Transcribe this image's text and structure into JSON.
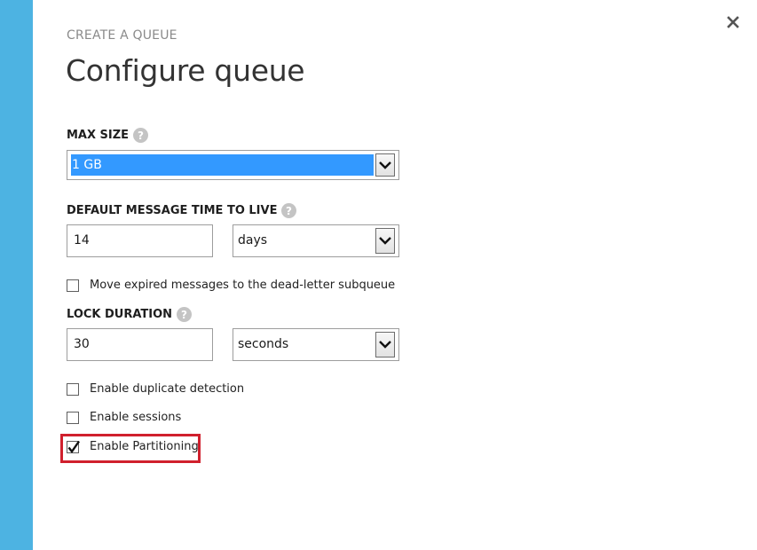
{
  "dialog": {
    "eyebrow": "CREATE A QUEUE",
    "title": "Configure queue",
    "close_icon": "close-icon",
    "accent_color": "#4db3e2"
  },
  "max_size": {
    "label": "MAX SIZE",
    "help_icon": "help-icon",
    "selected_value": "1 GB"
  },
  "message_ttl": {
    "label": "DEFAULT MESSAGE TIME TO LIVE",
    "help_icon": "help-icon",
    "value": "14",
    "unit": "days"
  },
  "dead_letter": {
    "label": "Move expired messages to the dead-letter subqueue",
    "checked": false
  },
  "lock_duration": {
    "label": "LOCK DURATION",
    "help_icon": "help-icon",
    "value": "30",
    "unit": "seconds"
  },
  "options": [
    {
      "label": "Enable duplicate detection",
      "checked": false
    },
    {
      "label": "Enable sessions",
      "checked": false
    },
    {
      "label": "Enable Partitioning",
      "checked": true,
      "highlight_color": "#d0202d"
    }
  ]
}
